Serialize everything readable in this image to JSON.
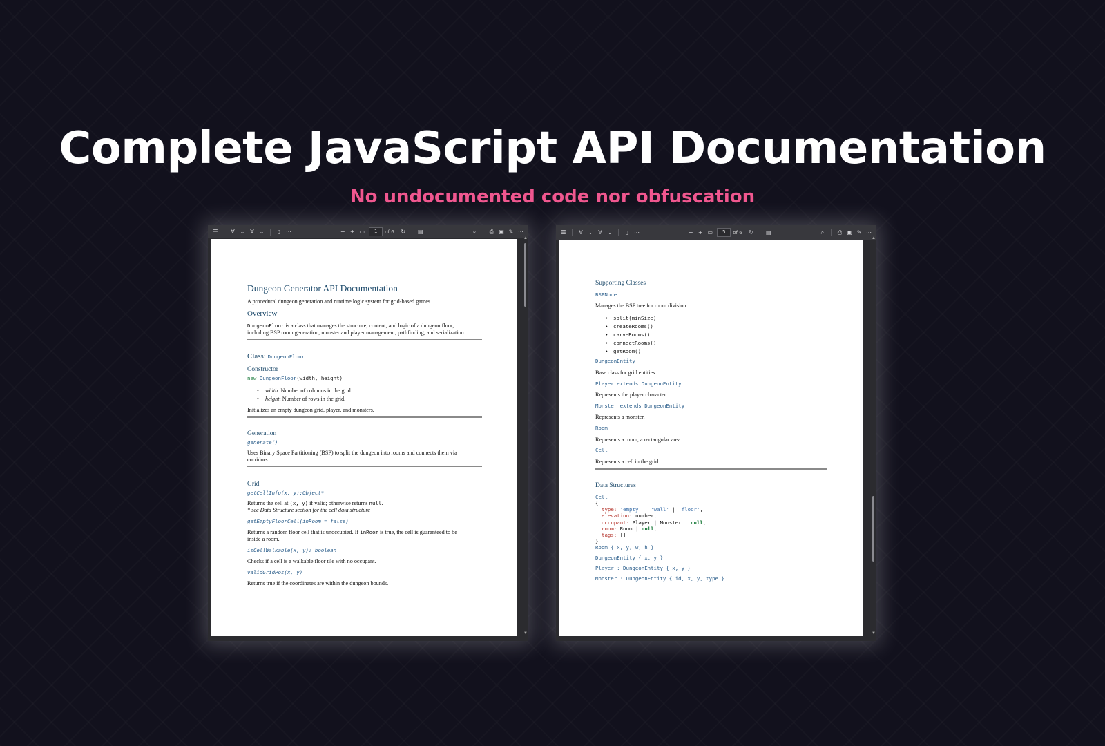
{
  "hero": {
    "title": "Complete JavaScript API Documentation",
    "subtitle": "No undocumented code nor obfuscation"
  },
  "left_viewer": {
    "page_number": "1",
    "page_total": "of 6",
    "doc": {
      "title": "Dungeon Generator API Documentation",
      "tagline": "A procedural dungeon generation and runtime logic system for grid-based games.",
      "overview_heading": "Overview",
      "overview_code": "DungeonFloor",
      "overview_text_1": " is a class that manages the structure, content, and logic of a dungeon floor,",
      "overview_text_2": "including BSP room generation, monster and player management, pathfinding, and serialization.",
      "class_heading_prefix": "Class: ",
      "class_heading_code": "DungeonFloor",
      "constructor_heading": "Constructor",
      "constructor_kw": "new",
      "constructor_name": "DungeonFloor",
      "constructor_args": "(width, height)",
      "params": [
        {
          "name": "width",
          "desc": ": Number of columns in the grid."
        },
        {
          "name": "height",
          "desc": ": Number of rows in the grid."
        }
      ],
      "constructor_desc": "Initializes an empty dungeon grid, player, and monsters.",
      "generation_heading": "Generation",
      "generation_sig": "generate()",
      "generation_desc_1": "Uses Binary Space Partitioning (BSP) to split the dungeon into rooms and connects them via",
      "generation_desc_2": "corridors.",
      "grid_heading": "Grid",
      "getcell_sig": "getCellInfo(x, y):Object*",
      "getcell_desc_a": "Returns the cell at ",
      "getcell_desc_code": "(x, y)",
      "getcell_desc_b": " if valid; otherwise returns ",
      "getcell_desc_null": "null",
      "getcell_desc_c": ".",
      "getcell_note": "* see Data Structure section for the cell data structure",
      "getempty_sig": "getEmptyFloorCell(inRoom = false)",
      "getempty_desc_a": "Returns a random floor cell that is unoccupied. If ",
      "getempty_desc_code": "inRoom",
      "getempty_desc_b": " is true, the cell is guaranteed to be",
      "getempty_desc_c": "inside a room.",
      "walkable_sig": "isCellWalkable(x, y): boolean",
      "walkable_desc": "Checks if a cell is a walkable floor tile with no occupant.",
      "valid_sig": "validGridPos(x, y)",
      "valid_desc": "Returns true if the coordinates are within the dungeon bounds."
    }
  },
  "right_viewer": {
    "page_number": "5",
    "page_total": "of 6",
    "doc": {
      "supporting_heading": "Supporting Classes",
      "bspnode_name": "BSPNode",
      "bspnode_desc": "Manages the BSP tree for room division.",
      "bspnode_methods": [
        "split(minSize)",
        "createRooms()",
        "carveRooms()",
        "connectRooms()",
        "getRoom()"
      ],
      "entity_name": "DungeonEntity",
      "entity_desc": "Base class for grid entities.",
      "player_name": "Player extends DungeonEntity",
      "player_desc": "Represents the player character.",
      "monster_name": "Monster extends DungeonEntity",
      "monster_desc": "Represents a monster.",
      "room_name": "Room",
      "room_desc": "Represents a room, a rectangular area.",
      "cell_name": "Cell",
      "cell_desc": "Represents a cell in the grid.",
      "data_heading": "Data Structures",
      "ds_cell_name": "Cell",
      "ds_open": "{",
      "ds_type_key": "type:",
      "ds_type_v1": "'empty'",
      "ds_type_v2": "'wall'",
      "ds_type_v3": "'floor'",
      "ds_pipe": "|",
      "ds_comma": ",",
      "ds_elev_key": "elevation:",
      "ds_elev_val": "number,",
      "ds_occ_key": "occupant:",
      "ds_occ_val1": "Player",
      "ds_occ_val2": "Monster",
      "ds_null": "null",
      "ds_room_key": "room:",
      "ds_room_val": "Room",
      "ds_tags_key": "tags:",
      "ds_tags_val": "[]",
      "ds_close": "}",
      "ds_room_struct": "Room { x, y, w, h }",
      "ds_entity_struct": "DungeonEntity { x, y }",
      "ds_player_struct": "Player : DungeonEntity { x, y }",
      "ds_monster_struct": "Monster : DungeonEntity { id, x, y, type }"
    }
  }
}
